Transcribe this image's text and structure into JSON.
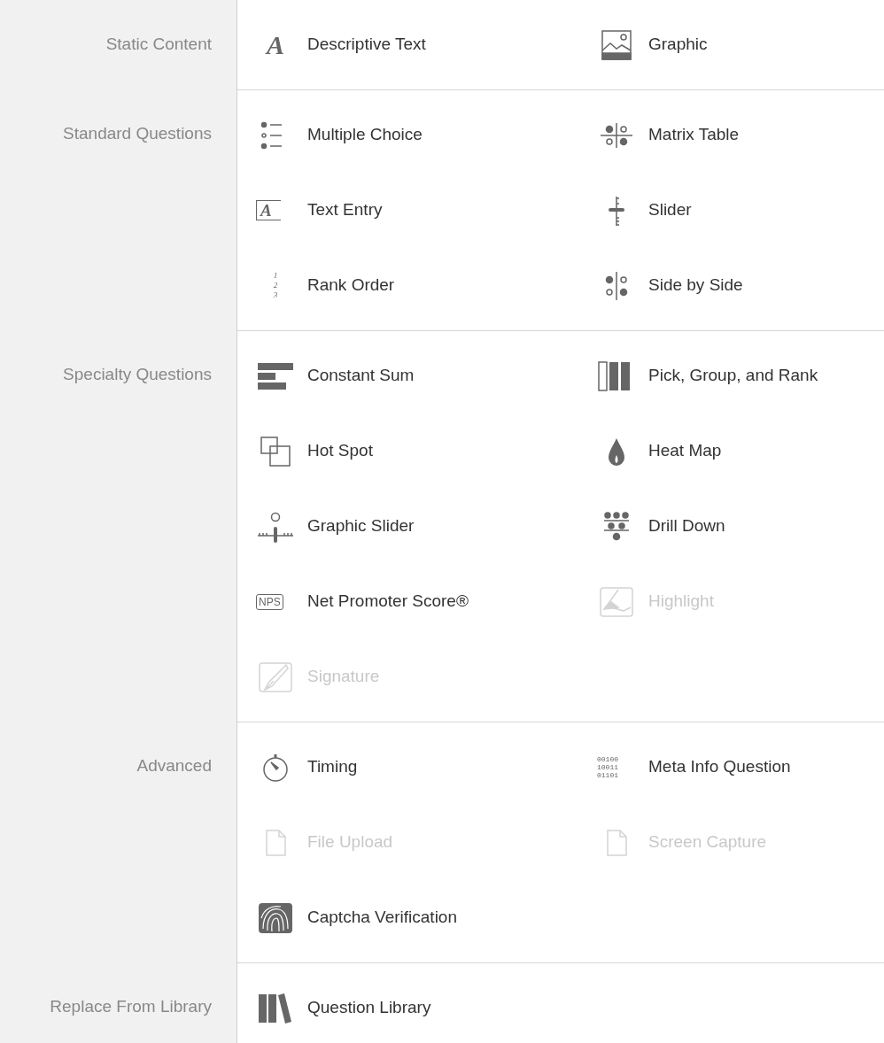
{
  "sections": [
    {
      "label": "Static Content",
      "items": [
        {
          "label": "Descriptive Text",
          "kind": "letter",
          "icon_text": "A",
          "disabled": false
        },
        {
          "label": "Graphic",
          "kind": "image",
          "disabled": false
        }
      ]
    },
    {
      "label": "Standard Questions",
      "items": [
        {
          "label": "Multiple Choice",
          "kind": "choices",
          "disabled": false
        },
        {
          "label": "Matrix Table",
          "kind": "matrix",
          "disabled": false
        },
        {
          "label": "Text Entry",
          "kind": "textentry",
          "icon_text": "A",
          "disabled": false
        },
        {
          "label": "Slider",
          "kind": "slider",
          "disabled": false
        },
        {
          "label": "Rank Order",
          "kind": "rank",
          "icon_lines": [
            "1",
            "2",
            "3"
          ],
          "disabled": false
        },
        {
          "label": "Side by Side",
          "kind": "sidebyside",
          "disabled": false
        }
      ]
    },
    {
      "label": "Specialty Questions",
      "items": [
        {
          "label": "Constant Sum",
          "kind": "bars",
          "disabled": false
        },
        {
          "label": "Pick, Group, and Rank",
          "kind": "columns",
          "disabled": false
        },
        {
          "label": "Hot Spot",
          "kind": "squares",
          "disabled": false
        },
        {
          "label": "Heat Map",
          "kind": "flame",
          "disabled": false
        },
        {
          "label": "Graphic Slider",
          "kind": "graphicslider",
          "disabled": false
        },
        {
          "label": "Drill Down",
          "kind": "drill",
          "disabled": false
        },
        {
          "label": "Net Promoter Score®",
          "kind": "badge",
          "icon_text": "NPS",
          "disabled": false
        },
        {
          "label": "Highlight",
          "kind": "highlight",
          "disabled": true
        },
        {
          "label": "Signature",
          "kind": "pen",
          "disabled": true
        }
      ]
    },
    {
      "label": "Advanced",
      "items": [
        {
          "label": "Timing",
          "kind": "stopwatch",
          "disabled": false
        },
        {
          "label": "Meta Info Question",
          "kind": "binary",
          "icon_lines": [
            "00100",
            "10011",
            "01101"
          ],
          "disabled": false
        },
        {
          "label": "File Upload",
          "kind": "file",
          "disabled": true
        },
        {
          "label": "Screen Capture",
          "kind": "file",
          "disabled": true
        },
        {
          "label": "Captcha Verification",
          "kind": "fingerprint",
          "disabled": false
        }
      ]
    },
    {
      "label": "Replace From Library",
      "items": [
        {
          "label": "Question Library",
          "kind": "books",
          "disabled": false
        }
      ]
    }
  ]
}
